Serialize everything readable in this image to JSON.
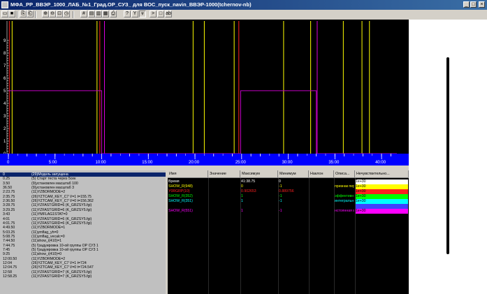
{
  "window": {
    "title": "МФА_РР_ВВЭР_1000_ЛАБ_№1_Град.ОР_СУЗ_ для ВОС_пуск_navin_ВВЭР-1000(tchernov-nb)",
    "minimize_glyph": "_",
    "maximize_glyph": "□",
    "close_glyph": "×"
  },
  "toolbar": {
    "icons": [
      "folder-open-icon",
      "save-icon",
      "copy-icon",
      "paste-icon",
      "zoom-in-icon",
      "zoom-out-icon",
      "zoom-fit-icon",
      "clock-icon",
      "grid-icon",
      "chart-icon",
      "chart-color-icon",
      "table-icon",
      "print-icon",
      "help-icon",
      "signal-icon",
      "wave-down-icon",
      "forward-icon",
      "stop-icon",
      "text-icon"
    ],
    "glyphs": [
      "▭",
      "■",
      "⎘",
      "⎗",
      "⊕",
      "⊖",
      "⊡",
      "◷",
      "#",
      "▤",
      "▥",
      "▦",
      "⎙",
      "?",
      "Y",
      "⩔",
      ">",
      "□",
      "ab"
    ]
  },
  "plot": {
    "background": "#000000",
    "y_ticks": [
      "9",
      "8",
      "7",
      "6",
      "5",
      "4",
      "3",
      "2",
      "1",
      "0"
    ],
    "x_ticks": [
      "0",
      "5:00",
      "10:00",
      "15:00",
      "20:00",
      "25:00",
      "30:00",
      "35:00",
      "40:00"
    ],
    "timeline_color": "#0000ff"
  },
  "chart_data": {
    "type": "line",
    "xlabel": "",
    "ylabel": "",
    "xlim_minutes": [
      0,
      41.64
    ],
    "ylim": [
      0,
      10
    ],
    "series": [
      {
        "color": "#c000c0",
        "points": [
          [
            0,
            5.01
          ],
          [
            10.0,
            5.01
          ],
          [
            10.0,
            0
          ],
          [
            24.9,
            0
          ],
          [
            24.9,
            5.01
          ],
          [
            33.0,
            5.01
          ],
          [
            33.0,
            0
          ],
          [
            41.64,
            0
          ]
        ]
      }
    ],
    "event_markers_minutes": {
      "red": [
        0.1,
        9.8,
        24.7
      ],
      "yellow": [
        0.4,
        9.5,
        19.8,
        21.0,
        24.2,
        29.5,
        32.4,
        35.9,
        37.9,
        38.7
      ],
      "magenta": [
        10.3,
        33.1
      ]
    }
  },
  "event_log": {
    "rows": [
      {
        "time": "0",
        "message": "(29)Модель запущена",
        "selected": true
      },
      {
        "time": "0.25",
        "message": "(5)  Старт теста через 5сек"
      },
      {
        "time": "3.50",
        "message": "(9)установлен масштаб 100"
      },
      {
        "time": "36.50",
        "message": "(9)установлен масштаб 3"
      },
      {
        "time": "2:23.75",
        "message": "(11)YZBORMODE=2"
      },
      {
        "time": "2:35.75",
        "message": "(26)YZTCAM_KEY_C7 V=1 t=155.75"
      },
      {
        "time": "2:36.50",
        "message": "(26)YZTCAM_KEY_C7 V=0 t=156.362"
      },
      {
        "time": "3:28.75",
        "message": "(11)YZFASTGRID=6  (K_GRZSY5.fgi)"
      },
      {
        "time": "3:29.25",
        "message": "(11)YZFASTGRID=6  (K_GRZSY5.fgi)"
      },
      {
        "time": "3:43",
        "message": "(11)YMFLAG1STAT=0"
      },
      {
        "time": "4:01",
        "message": "(11)YZFASTGRID=6  (K_GRZSY5.fgi)"
      },
      {
        "time": "4:01.75",
        "message": "(11)YZFASTGRID=6  (K_GRZSY5.fgi)"
      },
      {
        "time": "4:49.50",
        "message": "(11)YZBORMODE=1"
      },
      {
        "time": "5:03.25",
        "message": "(11)ymflag_yh=0"
      },
      {
        "time": "5:08.75",
        "message": "(11)ymflag_vecalc=0"
      },
      {
        "time": "7:44.50",
        "message": "(11)show_i(410)=1"
      },
      {
        "time": "7:44.75",
        "message": "(5)  Градуировка 10-ой группы ОР СУЗ  1"
      },
      {
        "time": "7:45",
        "message": "(5)  Градуировка 10-ой группы ОР СУЗ  1"
      },
      {
        "time": "9:25",
        "message": "(11)show_i(410)=0"
      },
      {
        "time": "12:00.50",
        "message": "(11)YZBORMODE=2"
      },
      {
        "time": "12:04",
        "message": "(26)YZTCAM_KEY_C7 V=1 t=724"
      },
      {
        "time": "12:04.75",
        "message": "(26)YZTCAM_KEY_C7 V=0 t=724.547"
      },
      {
        "time": "12:58",
        "message": "(11)YZFASTGRID=7  (K_GRZSY5.fgi)"
      },
      {
        "time": "12:58.25",
        "message": "(11)YZFASTGRID=7  (K_GRZSY5.fgi)"
      }
    ]
  },
  "signal_table": {
    "headers": [
      "Имя",
      "Значение",
      "Максимум",
      "Минимум",
      "Наклон",
      "Описа...",
      "Нечувствительно..."
    ],
    "rows": [
      {
        "name": "Время",
        "value": "",
        "max": "41:38.75",
        "min": "0",
        "slope": "",
        "desc": "",
        "dead": "1e+30",
        "color": "#ffffff"
      },
      {
        "name": "SHOW_R(948)",
        "value": "",
        "max": "0",
        "min": "-1",
        "slope": "",
        "desc": "признак пер",
        "dead": "1e+30",
        "color": "#ffff00"
      },
      {
        "name": "Y0RGRP(10)",
        "value": "",
        "max": "0.902653",
        "min": "0.889756",
        "slope": "",
        "desc": "",
        "dead": "1e+30",
        "color": "#ff2020"
      },
      {
        "name": "SHOW_R(352)",
        "value": "",
        "max": "1",
        "min": "-1",
        "slope": "",
        "desc": "эффективн",
        "dead": "1e+30",
        "color": "#00ff00"
      },
      {
        "name": "SHOW_R(351)",
        "value": "",
        "max": "1",
        "min": "-1",
        "slope": "",
        "desc": "интегральн",
        "dead": "1e+30",
        "color": "#00ffff"
      },
      {
        "name": "",
        "value": "",
        "max": "",
        "min": "",
        "slope": "",
        "desc": "",
        "dead": "",
        "color": "#4040ff"
      },
      {
        "name": "SHOW_R(551)",
        "value": "",
        "max": "1",
        "min": "-1",
        "slope": "",
        "desc": "нстоянная в",
        "dead": "1e+30",
        "color": "#ff00ff"
      }
    ]
  }
}
